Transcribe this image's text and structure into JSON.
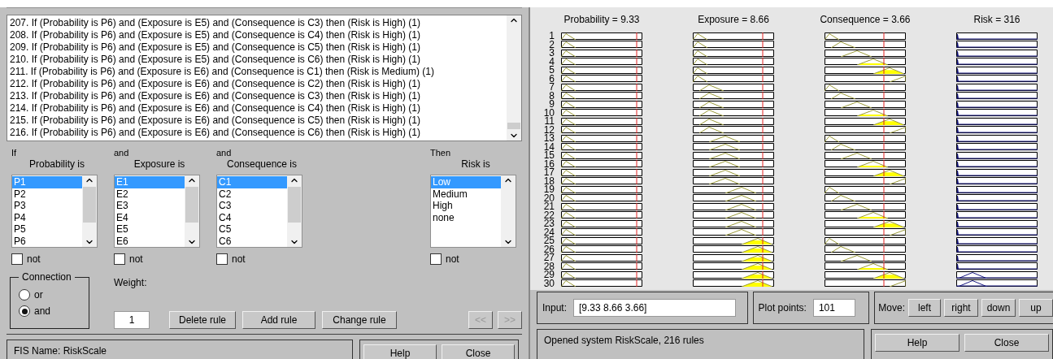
{
  "rule_editor": {
    "rules": [
      "207. If (Probability is P6) and (Exposure is E5) and (Consequence is C3) then (Risk is High) (1)",
      "208. If (Probability is P6) and (Exposure is E5) and (Consequence is C4) then (Risk is High) (1)",
      "209. If (Probability is P6) and (Exposure is E5) and (Consequence is C5) then (Risk is High) (1)",
      "210. If (Probability is P6) and (Exposure is E5) and (Consequence is C6) then (Risk is High) (1)",
      "211. If (Probability is P6) and (Exposure is E6) and (Consequence is C1) then (Risk is Medium) (1)",
      "212. If (Probability is P6) and (Exposure is E6) and (Consequence is C2) then (Risk is High) (1)",
      "213. If (Probability is P6) and (Exposure is E6) and (Consequence is C3) then (Risk is High) (1)",
      "214. If (Probability is P6) and (Exposure is E6) and (Consequence is C4) then (Risk is High) (1)",
      "215. If (Probability is P6) and (Exposure is E6) and (Consequence is C5) then (Risk is High) (1)",
      "216. If (Probability is P6) and (Exposure is E6) and (Consequence is C6) then (Risk is High) (1)"
    ],
    "antecedents": [
      {
        "connector": "If",
        "label": "Probability is",
        "items": [
          {
            "label": "P1",
            "selected": true
          },
          {
            "label": "P2",
            "selected": false
          },
          {
            "label": "P3",
            "selected": false
          },
          {
            "label": "P4",
            "selected": false
          },
          {
            "label": "P5",
            "selected": false
          },
          {
            "label": "P6",
            "selected": false
          }
        ],
        "not_label": "not",
        "not": false
      },
      {
        "connector": "and",
        "label": "Exposure is",
        "items": [
          {
            "label": "E1",
            "selected": true
          },
          {
            "label": "E2",
            "selected": false
          },
          {
            "label": "E3",
            "selected": false
          },
          {
            "label": "E4",
            "selected": false
          },
          {
            "label": "E5",
            "selected": false
          },
          {
            "label": "E6",
            "selected": false
          }
        ],
        "not_label": "not",
        "not": false
      },
      {
        "connector": "and",
        "label": "Consequence is",
        "items": [
          {
            "label": "C1",
            "selected": true
          },
          {
            "label": "C2",
            "selected": false
          },
          {
            "label": "C3",
            "selected": false
          },
          {
            "label": "C4",
            "selected": false
          },
          {
            "label": "C5",
            "selected": false
          },
          {
            "label": "C6",
            "selected": false
          }
        ],
        "not_label": "not",
        "not": false
      }
    ],
    "consequent": {
      "connector": "Then",
      "label": "Risk is",
      "items": [
        {
          "label": "Low",
          "selected": true
        },
        {
          "label": "Medium",
          "selected": false
        },
        {
          "label": "High",
          "selected": false
        },
        {
          "label": "none",
          "selected": false
        }
      ],
      "not_label": "not",
      "not": false
    },
    "connection": {
      "title": "Connection",
      "options": [
        {
          "label": "or",
          "selected": false
        },
        {
          "label": "and",
          "selected": true
        }
      ]
    },
    "weight": {
      "label": "Weight:",
      "value": "1"
    },
    "buttons": [
      {
        "label": "Delete rule",
        "disabled": false
      },
      {
        "label": "Add rule",
        "disabled": false
      },
      {
        "label": "Change rule",
        "disabled": false
      }
    ],
    "nav_buttons": [
      {
        "label": "<<",
        "disabled": true
      },
      {
        "label": ">>",
        "disabled": true
      }
    ],
    "status": "FIS Name: RiskScale",
    "footer_buttons": [
      "Help",
      "Close"
    ]
  },
  "rule_viewer": {
    "headers": [
      "Probability = 9.33",
      "Exposure = 8.66",
      "Consequence = 3.66",
      "Risk = 316"
    ],
    "rows": [
      "1",
      "2",
      "3",
      "4",
      "5",
      "6",
      "7",
      "8",
      "9",
      "10",
      "11",
      "12",
      "13",
      "14",
      "15",
      "16",
      "17",
      "18",
      "19",
      "20",
      "21",
      "22",
      "23",
      "24",
      "25",
      "26",
      "27",
      "28",
      "29",
      "30"
    ],
    "input": {
      "label": "Input:",
      "value": "[9.33 8.66 3.66]"
    },
    "plot_points": {
      "label": "Plot points:",
      "value": "101"
    },
    "move": {
      "label": "Move:",
      "buttons": [
        "left",
        "right",
        "down",
        "up"
      ]
    },
    "status": "Opened system RiskScale, 216 rules",
    "footer_buttons": [
      "Help",
      "Close"
    ]
  }
}
